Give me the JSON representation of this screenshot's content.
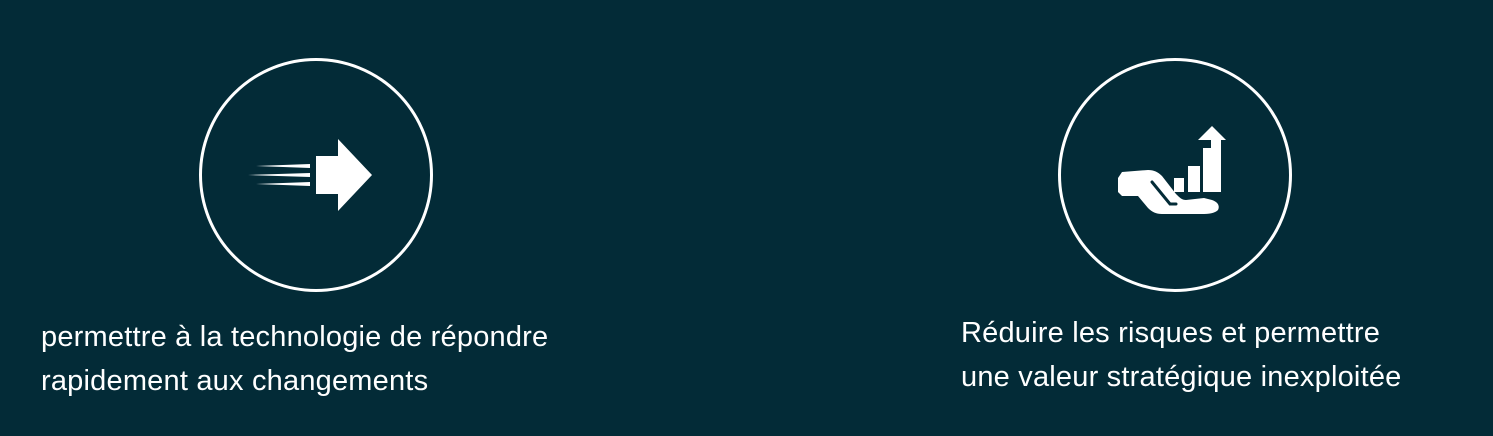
{
  "colors": {
    "background": "#032B37",
    "foreground": "#FFFFFF"
  },
  "features": [
    {
      "icon": "fast-arrow-icon",
      "caption_lines": [
        "permettre à la technologie de répondre",
        "rapidement aux changements"
      ]
    },
    {
      "icon": "hand-growth-chart-icon",
      "caption_lines": [
        "Réduire les risques et permettre",
        "une valeur stratégique inexploitée"
      ]
    }
  ]
}
